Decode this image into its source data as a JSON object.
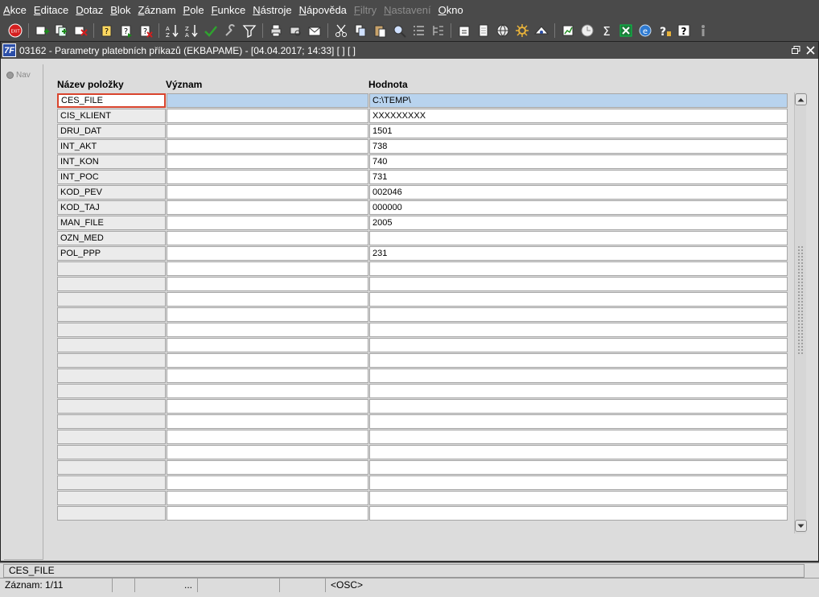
{
  "menu": [
    {
      "label": "Akce",
      "u": "A",
      "rest": "kce",
      "disabled": false
    },
    {
      "label": "Editace",
      "u": "E",
      "rest": "ditace",
      "disabled": false
    },
    {
      "label": "Dotaz",
      "u": "D",
      "rest": "otaz",
      "disabled": false
    },
    {
      "label": "Blok",
      "u": "B",
      "rest": "lok",
      "disabled": false
    },
    {
      "label": "Záznam",
      "u": "Z",
      "rest": "áznam",
      "disabled": false
    },
    {
      "label": "Pole",
      "u": "P",
      "rest": "ole",
      "disabled": false
    },
    {
      "label": "Funkce",
      "u": "F",
      "rest": "unkce",
      "disabled": false
    },
    {
      "label": "Nástroje",
      "u": "N",
      "rest": "ástroje",
      "disabled": false
    },
    {
      "label": "Nápověda",
      "u": "N",
      "rest": "ápověda",
      "disabled": false
    },
    {
      "label": "Filtry",
      "u": "F",
      "rest": "iltry",
      "disabled": true
    },
    {
      "label": "Nastavení",
      "u": "N",
      "rest": "astavení",
      "disabled": true
    },
    {
      "label": "Okno",
      "u": "O",
      "rest": "kno",
      "disabled": false
    }
  ],
  "toolbar_icons": [
    "exit-icon",
    "sep",
    "insert-record-icon",
    "duplicate-record-icon",
    "delete-record-icon",
    "sep",
    "query-icon",
    "execute-query-icon",
    "cancel-query-icon",
    "sep",
    "sort-asc-icon",
    "sort-desc-icon",
    "commit-icon",
    "tools-icon",
    "filter-icon",
    "sep",
    "print-icon",
    "print-preview-icon",
    "mail-icon",
    "sep",
    "cut-icon",
    "copy-icon",
    "paste-icon",
    "search-icon",
    "list-icon",
    "tree-icon",
    "sep",
    "export-icon",
    "document-icon",
    "globe-icon",
    "settings-wheel-icon",
    "eye-icon",
    "sep",
    "chart-icon",
    "clock-icon",
    "sigma-icon",
    "excel-icon",
    "browser-icon",
    "context-help-icon",
    "help-icon",
    "info-icon"
  ],
  "window": {
    "title": "03162 - Parametry platebních příkazů (EKBAPAME) - [04.04.2017; 14:33]  [ ]  [ ]",
    "app_icon_label": "7F"
  },
  "nav": {
    "label": "Nav"
  },
  "columns": {
    "name": "Název položky",
    "meaning": "Význam",
    "value": "Hodnota"
  },
  "rows": [
    {
      "name": "CES_FILE",
      "meaning": "",
      "value": "C:\\TEMP\\"
    },
    {
      "name": "CIS_KLIENT",
      "meaning": "",
      "value": "XXXXXXXXX"
    },
    {
      "name": "DRU_DAT",
      "meaning": "",
      "value": "1501"
    },
    {
      "name": "INT_AKT",
      "meaning": "",
      "value": "738"
    },
    {
      "name": "INT_KON",
      "meaning": "",
      "value": "740"
    },
    {
      "name": "INT_POC",
      "meaning": "",
      "value": "731"
    },
    {
      "name": "KOD_PEV",
      "meaning": "",
      "value": "002046"
    },
    {
      "name": "KOD_TAJ",
      "meaning": "",
      "value": "000000"
    },
    {
      "name": "MAN_FILE",
      "meaning": "",
      "value": "2005"
    },
    {
      "name": "OZN_MED",
      "meaning": "",
      "value": ""
    },
    {
      "name": "POL_PPP",
      "meaning": "",
      "value": "231"
    },
    {
      "name": "",
      "meaning": "",
      "value": ""
    },
    {
      "name": "",
      "meaning": "",
      "value": ""
    },
    {
      "name": "",
      "meaning": "",
      "value": ""
    },
    {
      "name": "",
      "meaning": "",
      "value": ""
    },
    {
      "name": "",
      "meaning": "",
      "value": ""
    },
    {
      "name": "",
      "meaning": "",
      "value": ""
    },
    {
      "name": "",
      "meaning": "",
      "value": ""
    },
    {
      "name": "",
      "meaning": "",
      "value": ""
    },
    {
      "name": "",
      "meaning": "",
      "value": ""
    },
    {
      "name": "",
      "meaning": "",
      "value": ""
    },
    {
      "name": "",
      "meaning": "",
      "value": ""
    },
    {
      "name": "",
      "meaning": "",
      "value": ""
    },
    {
      "name": "",
      "meaning": "",
      "value": ""
    },
    {
      "name": "",
      "meaning": "",
      "value": ""
    },
    {
      "name": "",
      "meaning": "",
      "value": ""
    },
    {
      "name": "",
      "meaning": "",
      "value": ""
    },
    {
      "name": "",
      "meaning": "",
      "value": ""
    }
  ],
  "active_row_index": 0,
  "status": {
    "field_text": "CES_FILE",
    "record": "Záznam: 1/11",
    "segment3": "...",
    "mode": "<OSC>"
  }
}
